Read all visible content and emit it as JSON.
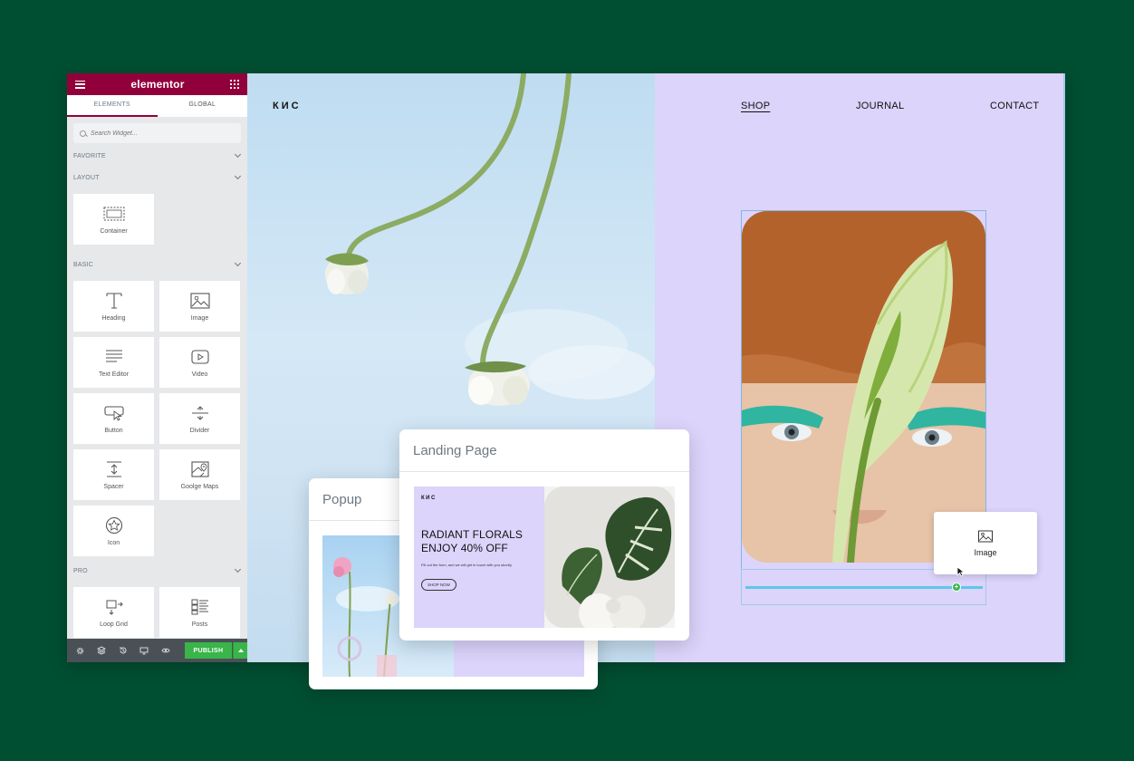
{
  "panel": {
    "logo": "elementor",
    "tabs": [
      "ELEMENTS",
      "GLOBAL"
    ],
    "search_placeholder": "Search Widget...",
    "sections": {
      "favorite": "FAVORITE",
      "layout": "LAYOUT",
      "basic": "BASIC",
      "pro": "PRO"
    },
    "layout_widgets": [
      {
        "label": "Container",
        "icon": "container-icon"
      }
    ],
    "basic_widgets": [
      {
        "label": "Heading",
        "icon": "heading-icon"
      },
      {
        "label": "Image",
        "icon": "image-icon"
      },
      {
        "label": "Text Editor",
        "icon": "text-editor-icon"
      },
      {
        "label": "Video",
        "icon": "video-icon"
      },
      {
        "label": "Button",
        "icon": "button-icon"
      },
      {
        "label": "Divider",
        "icon": "divider-icon"
      },
      {
        "label": "Spacer",
        "icon": "spacer-icon"
      },
      {
        "label": "Goolge Maps",
        "icon": "google-maps-icon"
      },
      {
        "label": "Icon",
        "icon": "star-icon"
      }
    ],
    "pro_widgets": [
      {
        "label": "Loop Grid",
        "icon": "loop-grid-icon"
      },
      {
        "label": "Posts",
        "icon": "posts-icon"
      }
    ],
    "footer": {
      "icons": [
        "settings-icon",
        "layers-icon",
        "history-icon",
        "responsive-icon",
        "preview-icon"
      ],
      "publish_label": "PUBLISH"
    },
    "accent_color": "#92003b",
    "publish_color": "#39b54a"
  },
  "site": {
    "logo": "КИС",
    "nav": [
      "SHOP",
      "JOURNAL",
      "CONTACT"
    ],
    "drag_widget_label": "Image"
  },
  "cards": {
    "popup": {
      "title": "Popup"
    },
    "landing": {
      "title": "Landing Page",
      "logo": "КИС",
      "headline_1": "RADIANT FLORALS",
      "headline_2": "ENJOY 40% OFF",
      "body": "Fill out the form, and we will get in touch with you shortly",
      "button": "SHOP NOW"
    }
  },
  "colors": {
    "background": "#014f32",
    "lilac": "#dcd4fb",
    "sky": "#c7e0f3",
    "drop_indicator": "#5bc8eb"
  }
}
